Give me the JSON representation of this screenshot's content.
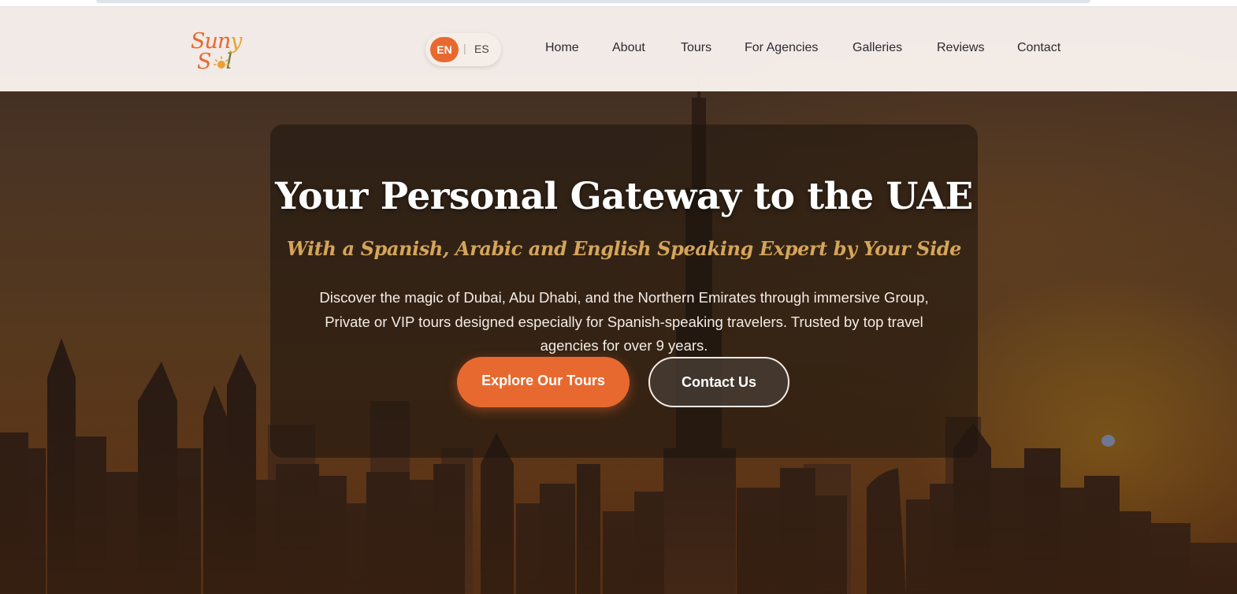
{
  "brand": {
    "logo_line1_a": "Sun",
    "logo_line1_b": "y",
    "logo_line2_a": "S",
    "logo_line2_b": "l",
    "accent_color": "#e8692f",
    "gold_color": "#d4a55a"
  },
  "language": {
    "active": "EN",
    "separator": "|",
    "other": "ES"
  },
  "nav": {
    "items": [
      {
        "label": "Home"
      },
      {
        "label": "About"
      },
      {
        "label": "Tours"
      },
      {
        "label": "For Agencies"
      },
      {
        "label": "Galleries"
      },
      {
        "label": "Reviews"
      },
      {
        "label": "Contact"
      }
    ]
  },
  "hero": {
    "title": "Your Personal Gateway to the UAE",
    "subtitle": "With a Spanish, Arabic and English Speaking Expert by Your Side",
    "description": "Discover the magic of Dubai, Abu Dhabi, and the Northern Emirates through immersive Group, Private or VIP tours designed especially for Spanish-speaking travelers. Trusted by top travel agencies for over 9 years.",
    "primary_button": "Explore Our Tours",
    "secondary_button": "Contact Us"
  }
}
